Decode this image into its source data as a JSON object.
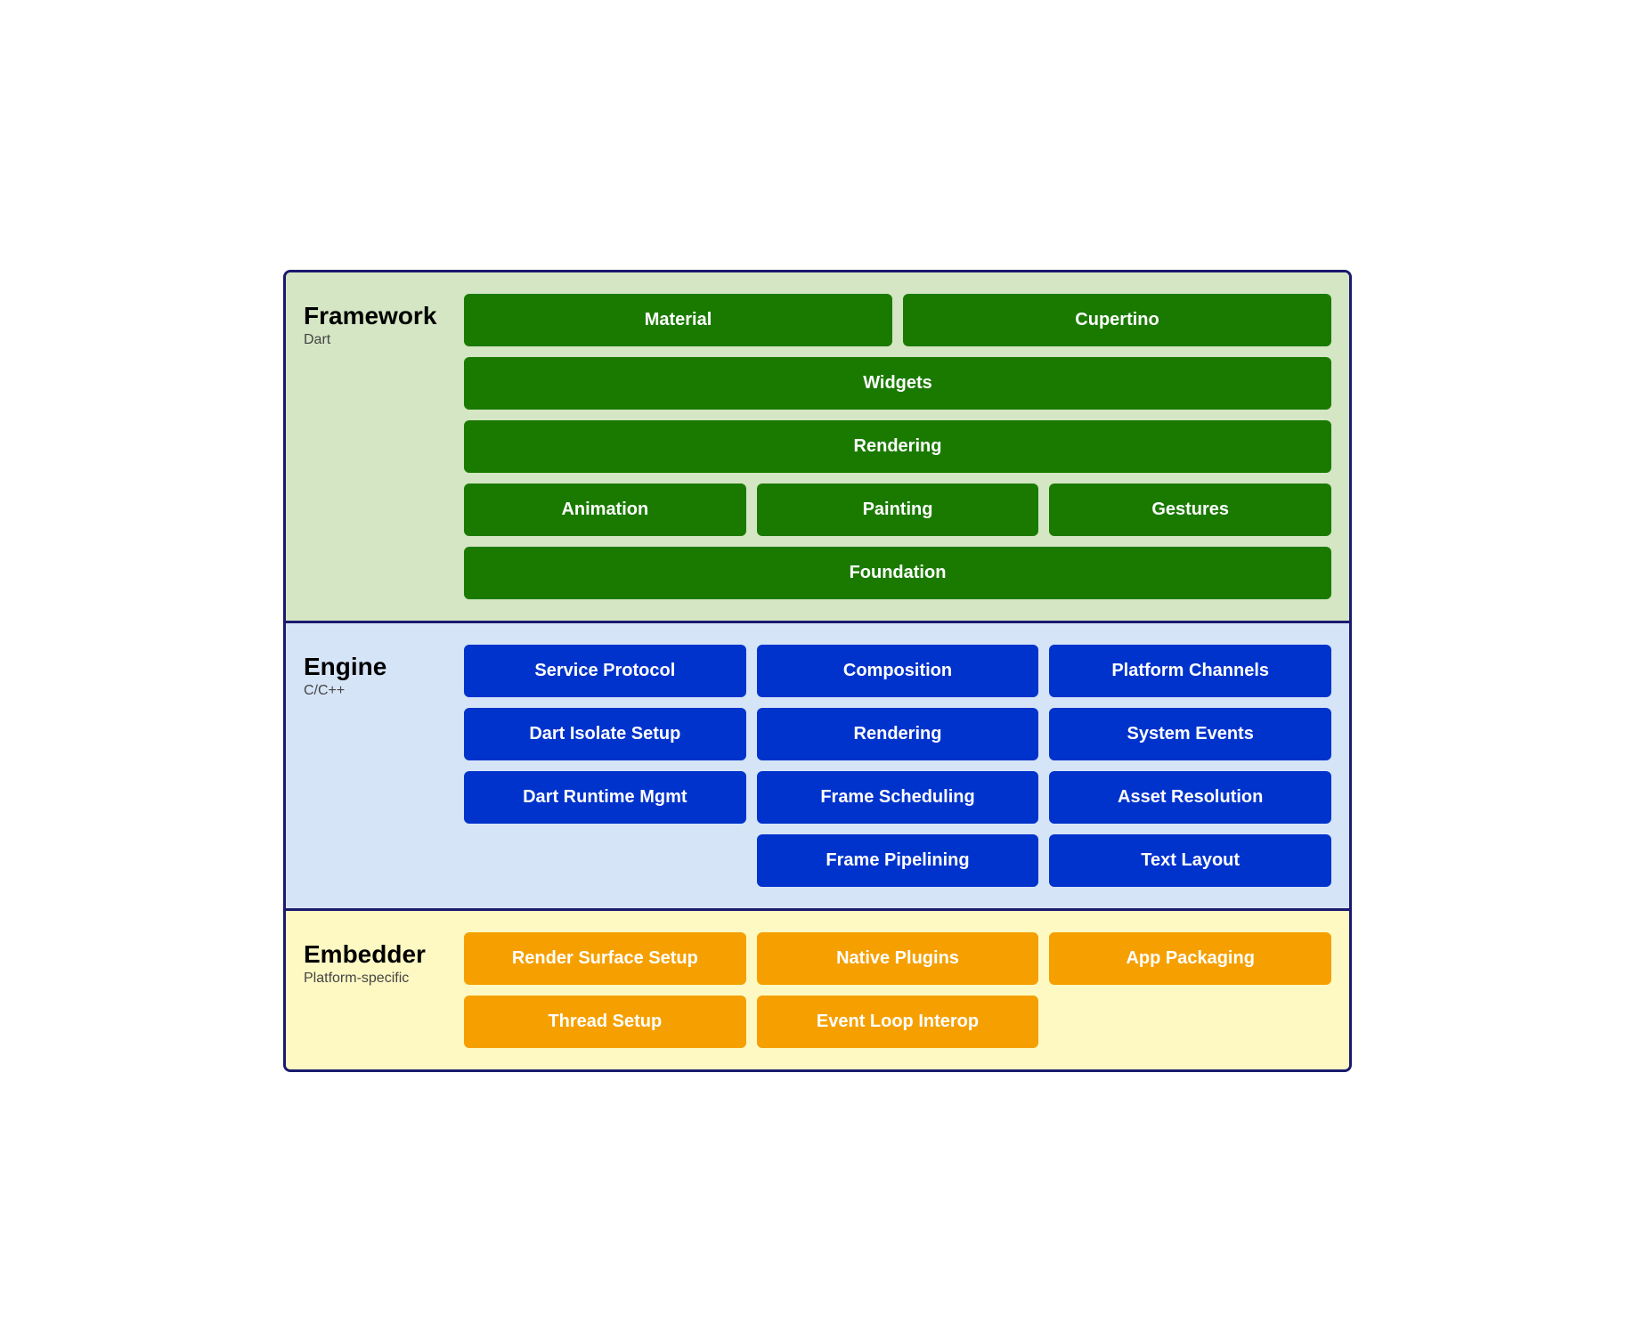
{
  "framework": {
    "title": "Framework",
    "subtitle": "Dart",
    "rows": [
      [
        {
          "label": "Material",
          "flex": 1
        },
        {
          "label": "Cupertino",
          "flex": 1
        }
      ],
      [
        {
          "label": "Widgets",
          "flex": 1
        }
      ],
      [
        {
          "label": "Rendering",
          "flex": 1
        }
      ],
      [
        {
          "label": "Animation",
          "flex": 1
        },
        {
          "label": "Painting",
          "flex": 1
        },
        {
          "label": "Gestures",
          "flex": 1
        }
      ],
      [
        {
          "label": "Foundation",
          "flex": 1
        }
      ]
    ]
  },
  "engine": {
    "title": "Engine",
    "subtitle": "C/C++",
    "rows": [
      [
        {
          "label": "Service Protocol",
          "flex": 1
        },
        {
          "label": "Composition",
          "flex": 1
        },
        {
          "label": "Platform Channels",
          "flex": 1
        }
      ],
      [
        {
          "label": "Dart Isolate Setup",
          "flex": 1
        },
        {
          "label": "Rendering",
          "flex": 1
        },
        {
          "label": "System Events",
          "flex": 1
        }
      ],
      [
        {
          "label": "Dart Runtime Mgmt",
          "flex": 1
        },
        {
          "label": "Frame Scheduling",
          "flex": 1
        },
        {
          "label": "Asset Resolution",
          "flex": 1
        }
      ],
      [
        {
          "label": "",
          "flex": 1,
          "invisible": true
        },
        {
          "label": "Frame Pipelining",
          "flex": 1
        },
        {
          "label": "Text Layout",
          "flex": 1
        }
      ]
    ]
  },
  "embedder": {
    "title": "Embedder",
    "subtitle": "Platform-specific",
    "rows": [
      [
        {
          "label": "Render Surface Setup",
          "flex": 1
        },
        {
          "label": "Native Plugins",
          "flex": 1
        },
        {
          "label": "App Packaging",
          "flex": 1
        }
      ],
      [
        {
          "label": "Thread Setup",
          "flex": 1
        },
        {
          "label": "Event Loop Interop",
          "flex": 1
        },
        {
          "label": "",
          "flex": 1,
          "invisible": true
        }
      ]
    ]
  }
}
